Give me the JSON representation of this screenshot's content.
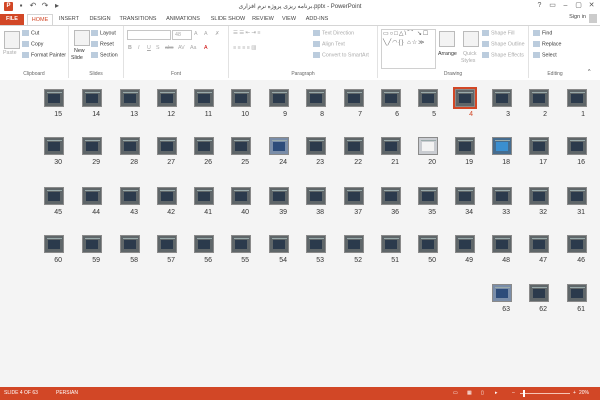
{
  "app": {
    "logo": "P",
    "title": "برنامه ریزی پروژه نرم افزاری.pptx - PowerPoint"
  },
  "qat": [
    "save-icon",
    "undo-icon",
    "redo-icon",
    "slideshow-icon"
  ],
  "window_controls": [
    "?",
    "▭",
    "–",
    "▢",
    "✕"
  ],
  "tabs": [
    "FILE",
    "HOME",
    "INSERT",
    "DESIGN",
    "TRANSITIONS",
    "ANIMATIONS",
    "SLIDE SHOW",
    "REVIEW",
    "VIEW",
    "ADD-INS"
  ],
  "active_tab": "HOME",
  "signin": "Sign in",
  "ribbon": {
    "clipboard": {
      "label": "Clipboard",
      "paste": "Paste",
      "cut": "Cut",
      "copy": "Copy",
      "format_painter": "Format Painter"
    },
    "slides": {
      "label": "Slides",
      "new_slide": "New",
      "new_slide2": "Slide",
      "layout": "Layout",
      "reset": "Reset",
      "section": "Section"
    },
    "font": {
      "label": "Font",
      "size": "48",
      "buttons": [
        "B",
        "I",
        "U",
        "S",
        "abc",
        "AV",
        "Aa",
        "A"
      ]
    },
    "paragraph": {
      "label": "Paragraph",
      "text_direction": "Text Direction",
      "align_text": "Align Text",
      "smartart": "Convert to SmartArt"
    },
    "drawing": {
      "label": "Drawing",
      "arrange": "Arrange",
      "quick_styles": "Quick",
      "quick_styles2": "Styles",
      "shape_fill": "Shape Fill",
      "shape_outline": "Shape Outline",
      "shape_effects": "Shape Effects",
      "shapes_glyphs": "▭○□△\\⌒ ↘☐ ╲╱◠{} ⌂☆≫"
    },
    "editing": {
      "label": "Editing",
      "find": "Find",
      "replace": "Replace",
      "select": "Select"
    }
  },
  "slides": {
    "total": 63,
    "selected": 4,
    "rows": [
      [
        15,
        14,
        13,
        12,
        11,
        10,
        9,
        8,
        7,
        6,
        5,
        4,
        3,
        2,
        1
      ],
      [
        30,
        29,
        28,
        27,
        26,
        25,
        24,
        23,
        22,
        21,
        20,
        19,
        18,
        17,
        16
      ],
      [
        45,
        44,
        43,
        42,
        41,
        40,
        39,
        38,
        37,
        36,
        35,
        34,
        33,
        32,
        31
      ],
      [
        60,
        59,
        58,
        57,
        56,
        55,
        54,
        53,
        52,
        51,
        50,
        49,
        48,
        47,
        46
      ],
      [
        63,
        62,
        61
      ]
    ],
    "image_slides": [
      24,
      63
    ],
    "light_slides": [
      20
    ],
    "triangle_slides": [
      18
    ]
  },
  "status": {
    "slide_info": "SLIDE 4 OF 63",
    "language": "PERSIAN",
    "zoom": "20%"
  }
}
